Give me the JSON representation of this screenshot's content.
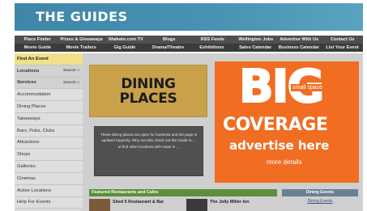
{
  "banner": {
    "title": "THE GUIDES"
  },
  "nav_primary": [
    "Place Finder",
    "Prizes & Giveaways",
    "Waikato.com TV",
    "Blogs",
    "RSS Feeds",
    "Wellington Jobs",
    "Advertise With Us",
    "Contact Us"
  ],
  "nav_secondary": [
    "Movie Guide",
    "Movie Trailers",
    "Gig Guide",
    "Drama/Theatre",
    "Exhibitions",
    "Sales Calendar",
    "Business Calendar",
    "List Your Event"
  ],
  "sidebar": {
    "items": [
      {
        "label": "Find An Event",
        "style": "highlight"
      },
      {
        "label": "Locations",
        "style": "bold",
        "search": "Search »"
      },
      {
        "label": "Services",
        "style": "bold",
        "search": "Search »"
      },
      {
        "label": "Accommodation"
      },
      {
        "label": "Dining Places"
      },
      {
        "label": "Takeaways"
      },
      {
        "label": "Bars, Pubs, Clubs"
      },
      {
        "label": "Attractions"
      },
      {
        "label": "Shops"
      },
      {
        "label": "Galleries"
      },
      {
        "label": "Cinemas"
      },
      {
        "label": "Active Locations"
      },
      {
        "label": "Help For Events"
      }
    ]
  },
  "dining": {
    "line1": "DINING",
    "line2": "PLACES",
    "info": "These dining places are open for business and the page is updated regularly. Why not also check out the Guide to ... or find other locations with maps in ..."
  },
  "ad": {
    "big": "BIG",
    "small": "small space",
    "coverage": "COVERAGE",
    "advertise": "advertise here",
    "more": "more details",
    "color": "#f06d22"
  },
  "featured": {
    "title": "Featured Restaurants and Cafes",
    "items": [
      "Shed 5 Restaurant & Bar",
      "The Jolly Miller Inn"
    ]
  },
  "events": {
    "title": "Dining Events",
    "link": "Dining Events"
  }
}
